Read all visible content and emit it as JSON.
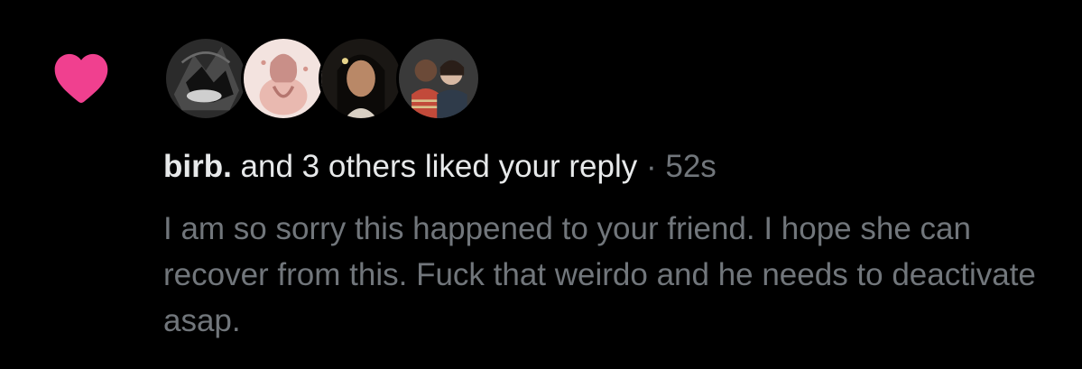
{
  "notification": {
    "type": "like",
    "icon": "heart-icon",
    "icon_color": "#f91880",
    "avatars": [
      {
        "name": "avatar-1"
      },
      {
        "name": "avatar-2"
      },
      {
        "name": "avatar-3"
      },
      {
        "name": "avatar-4"
      }
    ],
    "username": "birb.",
    "action_text": " and 3 others liked your reply",
    "separator": " · ",
    "timestamp": "52s",
    "reply_text": "I am so sorry this happened to your friend. I hope she can recover from this. Fuck that weirdo and he needs to deactivate asap."
  },
  "colors": {
    "background": "#000000",
    "primary_text": "#e7e9ea",
    "secondary_text": "#71767b",
    "like": "#f91880"
  }
}
